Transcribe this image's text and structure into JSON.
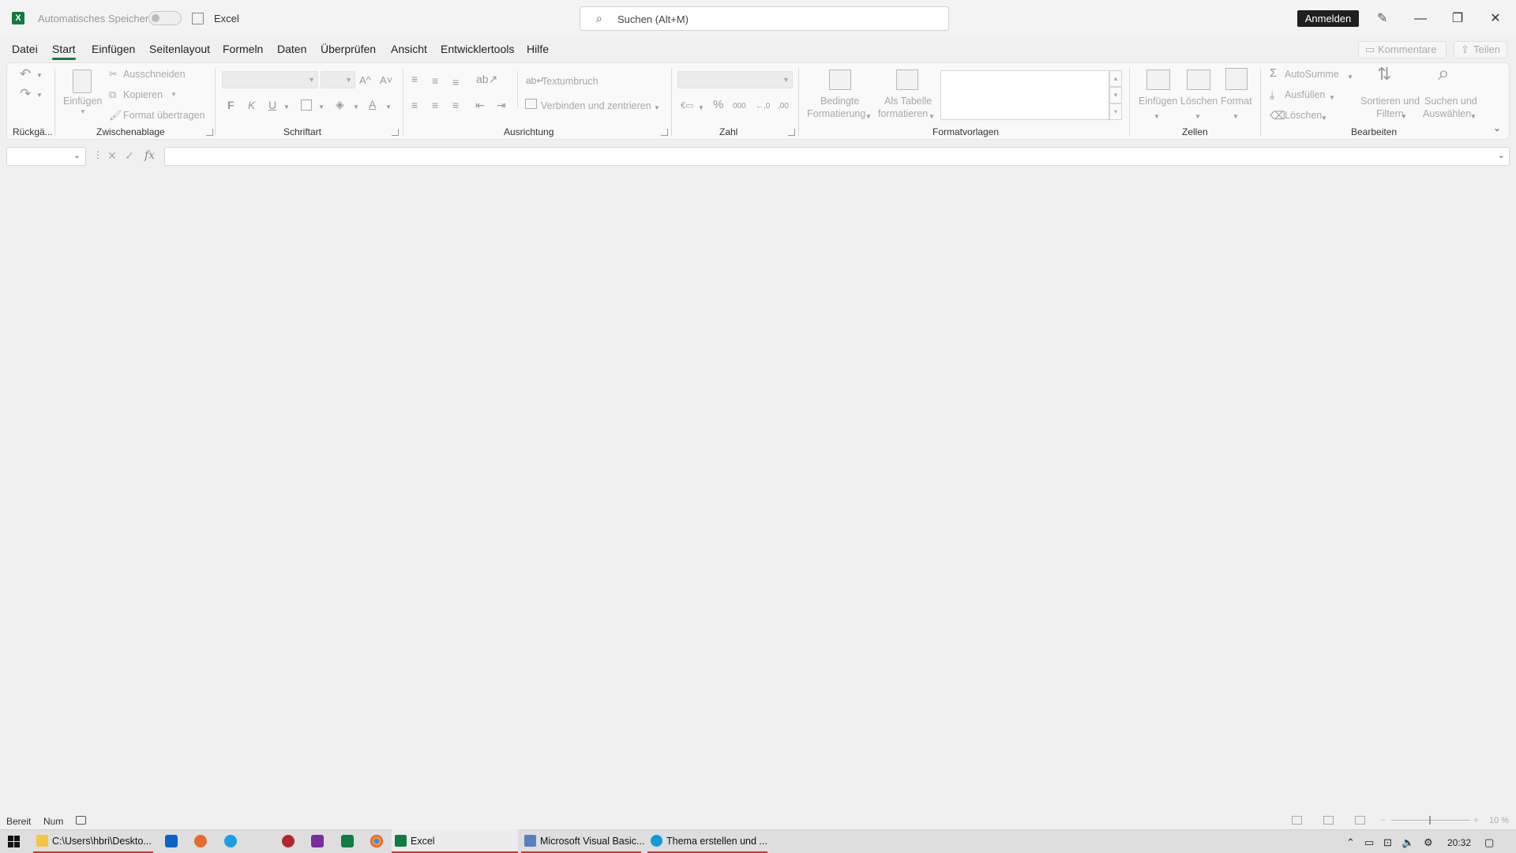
{
  "titlebar": {
    "autosave_label": "Automatisches Speichern",
    "app_title": "Excel",
    "search_placeholder": "Suchen (Alt+M)",
    "signin_label": "Anmelden"
  },
  "tabs": [
    "Datei",
    "Start",
    "Einfügen",
    "Seitenlayout",
    "Formeln",
    "Daten",
    "Überprüfen",
    "Ansicht",
    "Entwicklertools",
    "Hilfe"
  ],
  "active_tab": "Start",
  "header_buttons": {
    "comments": "Kommentare",
    "share": "Teilen"
  },
  "ribbon": {
    "undo": {
      "label": "Rückgä..."
    },
    "clipboard": {
      "label": "Zwischenablage",
      "paste": "Einfügen",
      "cut": "Ausschneiden",
      "copy": "Kopieren",
      "format_painter": "Format übertragen"
    },
    "font": {
      "label": "Schriftart",
      "bold": "F",
      "italic": "K",
      "underline": "U",
      "grow": "A^",
      "shrink": "A˅"
    },
    "alignment": {
      "label": "Ausrichtung",
      "wrap_text": "Textumbruch",
      "merge_center": "Verbinden und zentrieren"
    },
    "number": {
      "label": "Zahl",
      "percent": "%",
      "thousands": "000",
      "inc_decimal": "←,0",
      "dec_decimal": ",00"
    },
    "styles": {
      "label": "Formatvorlagen",
      "conditional_line1": "Bedingte",
      "conditional_line2": "Formatierung",
      "as_table_line1": "Als Tabelle",
      "as_table_line2": "formatieren"
    },
    "cells": {
      "label": "Zellen",
      "insert": "Einfügen",
      "delete": "Löschen",
      "format": "Format"
    },
    "editing": {
      "label": "Bearbeiten",
      "autosum": "AutoSumme",
      "fill": "Ausfüllen",
      "clear": "Löschen",
      "sort_line1": "Sortieren und",
      "sort_line2": "Filtern",
      "find_line1": "Suchen und",
      "find_line2": "Auswählen"
    }
  },
  "formula_bar": {
    "fx": "fx"
  },
  "statusbar": {
    "ready": "Bereit",
    "num": "Num",
    "zoom": "10 %"
  },
  "taskbar": {
    "explorer": "C:\\Users\\hbri\\Deskto...",
    "excel": "Excel",
    "vba": "Microsoft Visual Basic...",
    "edge": "Thema erstellen und ...",
    "time": "20:32"
  },
  "colors": {
    "accent": "#107c41",
    "taskbar_running": "#d42f2f"
  }
}
